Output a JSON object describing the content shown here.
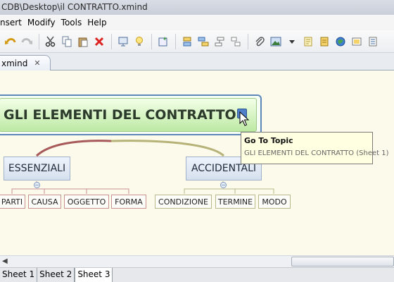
{
  "window": {
    "title": "CDB\\Desktop\\il CONTRATTO.xmind"
  },
  "menu": [
    "nsert",
    "Modify",
    "Tools",
    "Help"
  ],
  "toolbar_icons": [
    "undo-icon",
    "redo-icon",
    "cut-icon",
    "copy-icon",
    "paste-icon",
    "delete-icon",
    "presentation-icon",
    "lightbulb-icon",
    "new-topic-icon",
    "insert-topic-icon",
    "insert-subtopic-icon",
    "insert-parent-icon",
    "detach-icon",
    "attachment-icon",
    "image-icon",
    "dropdown-icon",
    "notes-icon",
    "marker-icon",
    "hyperlink-icon",
    "label-icon",
    "outline-icon"
  ],
  "editor_tab": {
    "label": "xmind",
    "close": "✕"
  },
  "map": {
    "central_topic": "GLI ELEMENTI DEL CONTRATTO",
    "branches": [
      {
        "label": "ESSENZIALI",
        "color": "#a85a5a",
        "subtopics": [
          "PARTI",
          "CAUSA",
          "OGGETTO",
          "FORMA"
        ]
      },
      {
        "label": "ACCIDENTALI",
        "color": "#a9a56a",
        "subtopics": [
          "CONDIZIONE",
          "TERMINE",
          "MODO"
        ]
      }
    ]
  },
  "tooltip": {
    "title": "Go To Topic",
    "body": "GLI ELEMENTI DEL CONTRATTO (Sheet 1)"
  },
  "sheets": [
    "Sheet 1",
    "Sheet 2",
    "Sheet 3"
  ],
  "active_sheet": "Sheet 3",
  "collapse_symbol": "−",
  "scroll_left_arrow": "◀"
}
